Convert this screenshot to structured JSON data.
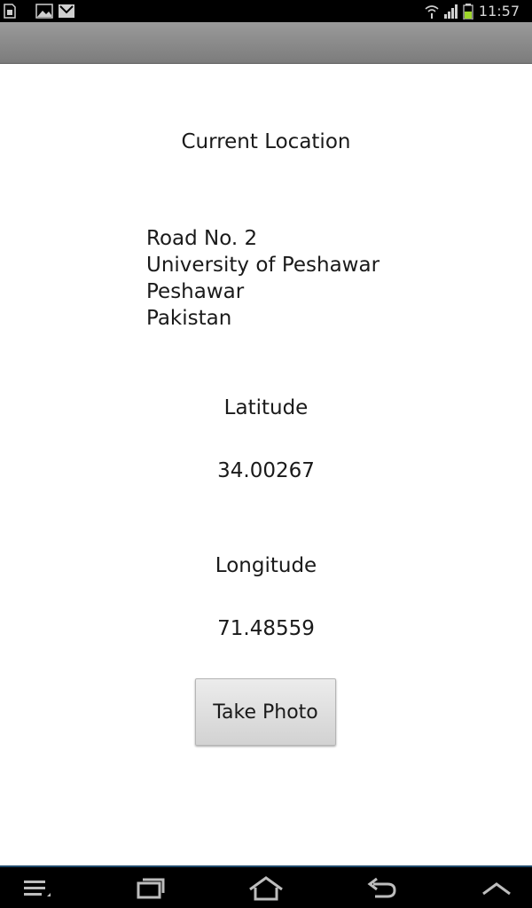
{
  "status_bar": {
    "time": "11:57",
    "icons": [
      "sd-card-icon",
      "image-icon",
      "gmail-icon",
      "wifi-icon",
      "signal-icon",
      "battery-icon"
    ]
  },
  "content": {
    "current_location_label": "Current Location",
    "address": {
      "line1": "Road No. 2",
      "line2": "University of Peshawar",
      "line3": "Peshawar",
      "line4": "Pakistan"
    },
    "latitude_label": "Latitude",
    "latitude_value": "34.00267",
    "longitude_label": "Longitude",
    "longitude_value": "71.48559",
    "take_photo_label": "Take Photo"
  },
  "nav_bar": {
    "icons": [
      "menu-icon",
      "recent-apps-icon",
      "home-icon",
      "back-icon",
      "up-chevron-icon"
    ]
  }
}
